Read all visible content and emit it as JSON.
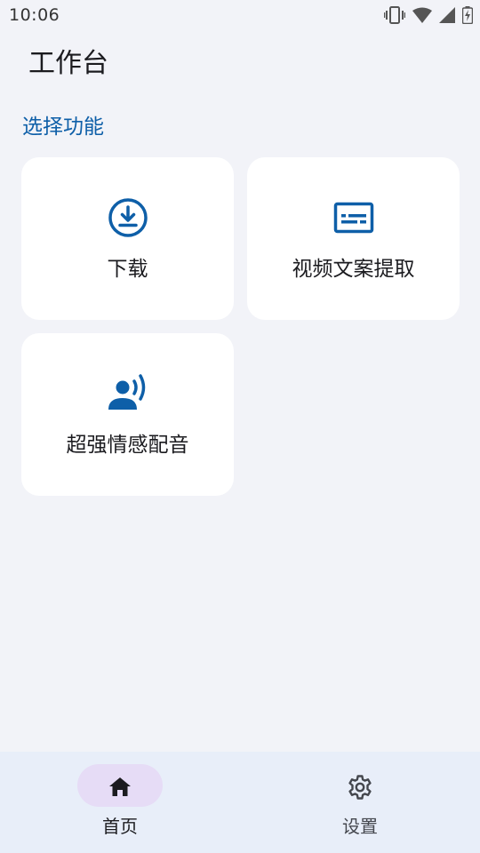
{
  "status_bar": {
    "time": "10:06"
  },
  "header": {
    "title": "工作台"
  },
  "section": {
    "title": "选择功能"
  },
  "features": [
    {
      "label": "下载",
      "icon": "download-icon"
    },
    {
      "label": "视频文案提取",
      "icon": "subtitles-icon"
    },
    {
      "label": "超强情感配音",
      "icon": "voice-icon"
    }
  ],
  "bottom_nav": {
    "items": [
      {
        "label": "首页",
        "icon": "home-icon",
        "active": true
      },
      {
        "label": "设置",
        "icon": "gear-icon",
        "active": false
      }
    ]
  },
  "colors": {
    "accent": "#0e5fa8",
    "background": "#f2f3f8",
    "card": "#ffffff",
    "nav_background": "#e8eef9",
    "nav_active_pill": "#e6dcf6"
  }
}
